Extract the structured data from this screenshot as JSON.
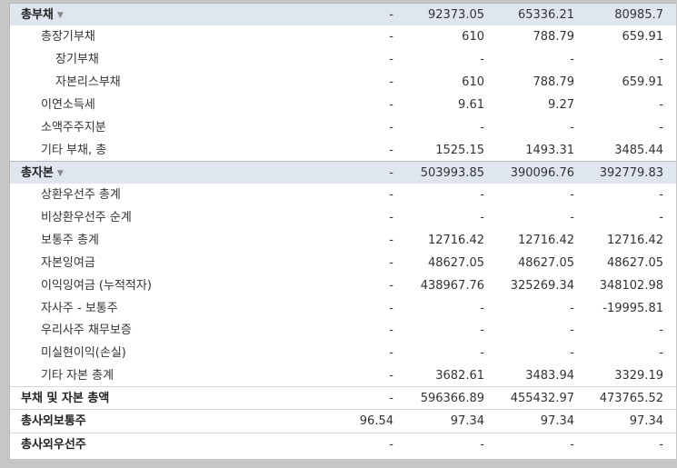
{
  "rows": [
    {
      "label": "총부채",
      "kind": "section",
      "level": 0,
      "values": [
        "-",
        "92373.05",
        "65336.21",
        "80985.7"
      ]
    },
    {
      "label": "총장기부채",
      "kind": "item",
      "level": 1,
      "values": [
        "-",
        "610",
        "788.79",
        "659.91"
      ]
    },
    {
      "label": "장기부채",
      "kind": "item",
      "level": 2,
      "values": [
        "-",
        "-",
        "-",
        "-"
      ]
    },
    {
      "label": "자본리스부채",
      "kind": "item",
      "level": 2,
      "values": [
        "-",
        "610",
        "788.79",
        "659.91"
      ]
    },
    {
      "label": "이연소득세",
      "kind": "item",
      "level": 1,
      "values": [
        "-",
        "9.61",
        "9.27",
        "-"
      ]
    },
    {
      "label": "소액주주지분",
      "kind": "item",
      "level": 1,
      "values": [
        "-",
        "-",
        "-",
        "-"
      ]
    },
    {
      "label": "기타 부채, 총",
      "kind": "item",
      "level": 1,
      "values": [
        "-",
        "1525.15",
        "1493.31",
        "3485.44"
      ]
    },
    {
      "label": "총자본",
      "kind": "section",
      "level": 0,
      "values": [
        "-",
        "503993.85",
        "390096.76",
        "392779.83"
      ]
    },
    {
      "label": "상환우선주 총계",
      "kind": "item",
      "level": 1,
      "values": [
        "-",
        "-",
        "-",
        "-"
      ]
    },
    {
      "label": "비상환우선주 순계",
      "kind": "item",
      "level": 1,
      "values": [
        "-",
        "-",
        "-",
        "-"
      ]
    },
    {
      "label": "보통주 총계",
      "kind": "item",
      "level": 1,
      "values": [
        "-",
        "12716.42",
        "12716.42",
        "12716.42"
      ]
    },
    {
      "label": "자본잉여금",
      "kind": "item",
      "level": 1,
      "values": [
        "-",
        "48627.05",
        "48627.05",
        "48627.05"
      ]
    },
    {
      "label": "이익잉여금 (누적적자)",
      "kind": "item",
      "level": 1,
      "values": [
        "-",
        "438967.76",
        "325269.34",
        "348102.98"
      ]
    },
    {
      "label": "자사주 - 보통주",
      "kind": "item",
      "level": 1,
      "values": [
        "-",
        "-",
        "-",
        "-19995.81"
      ]
    },
    {
      "label": "우리사주 채무보증",
      "kind": "item",
      "level": 1,
      "values": [
        "-",
        "-",
        "-",
        "-"
      ]
    },
    {
      "label": "미실현이익(손실)",
      "kind": "item",
      "level": 1,
      "values": [
        "-",
        "-",
        "-",
        "-"
      ]
    },
    {
      "label": "기타 자본 총계",
      "kind": "item",
      "level": 1,
      "values": [
        "-",
        "3682.61",
        "3483.94",
        "3329.19"
      ]
    },
    {
      "label": "부채 및 자본 총액",
      "kind": "total",
      "level": 0,
      "values": [
        "-",
        "596366.89",
        "455432.97",
        "473765.52"
      ]
    },
    {
      "label": "총사외보통주",
      "kind": "total",
      "level": 0,
      "values": [
        "96.54",
        "97.34",
        "97.34",
        "97.34"
      ]
    },
    {
      "label": "총사외우선주",
      "kind": "total",
      "level": 0,
      "values": [
        "-",
        "-",
        "-",
        "-"
      ]
    }
  ],
  "icons": {
    "expand": "chevron-down-icon"
  }
}
